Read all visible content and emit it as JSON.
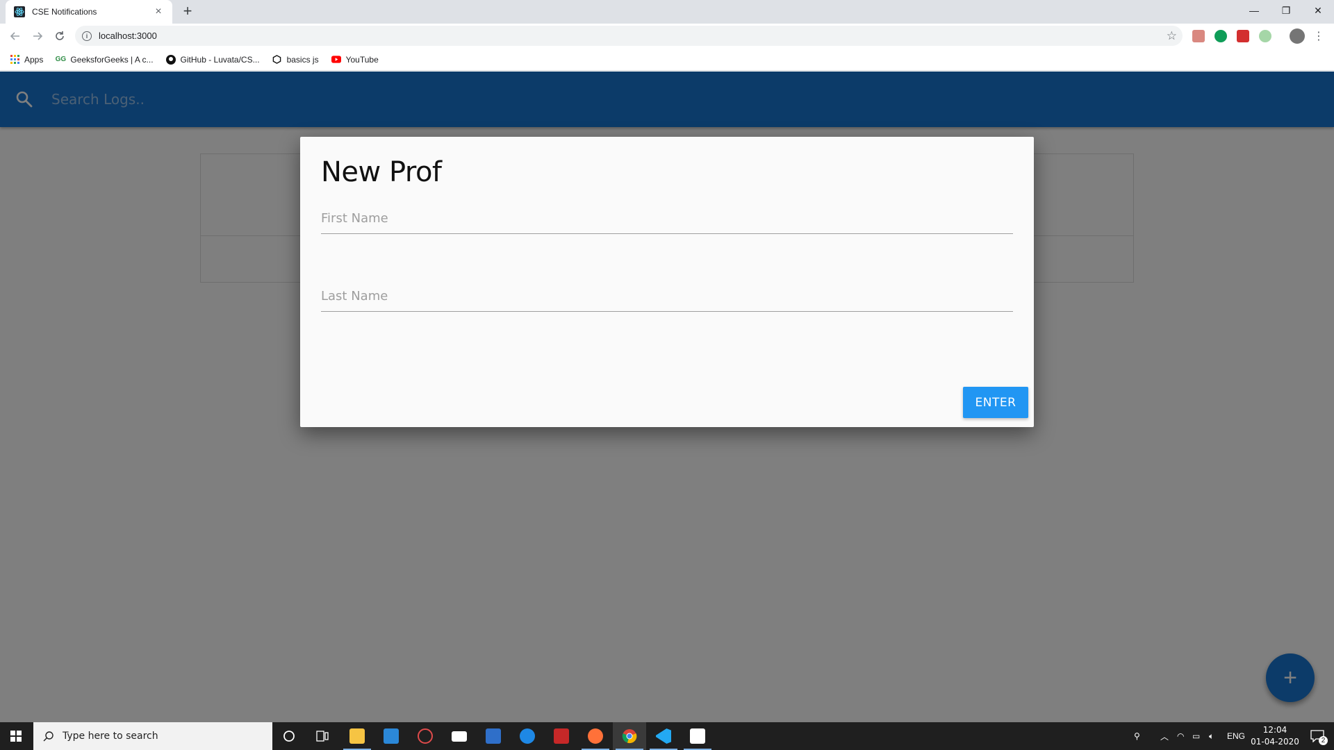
{
  "browser": {
    "tab_title": "CSE Notifications",
    "tab_close": "×",
    "new_tab": "+",
    "url": "localhost:3000",
    "window_controls": [
      "—",
      "❐",
      "✕"
    ],
    "bookmarks": [
      {
        "label": "Apps",
        "icon": "apps-grid-icon"
      },
      {
        "label": "GeeksforGeeks | A c...",
        "icon": "geeksforgeeks-icon"
      },
      {
        "label": "GitHub - Luvata/CS...",
        "icon": "github-icon"
      },
      {
        "label": "basics js",
        "icon": "codesandbox-icon"
      },
      {
        "label": "YouTube",
        "icon": "youtube-icon"
      }
    ]
  },
  "app": {
    "search_placeholder": "Search Logs..",
    "fab_label": "+"
  },
  "modal": {
    "title": "New Prof",
    "first_name_placeholder": "First Name",
    "last_name_placeholder": "Last Name",
    "enter_label": "ENTER"
  },
  "taskbar": {
    "search_placeholder": "Type here to search",
    "language": "ENG",
    "time": "12:04",
    "date": "01-04-2020",
    "notification_count": "2"
  },
  "colors": {
    "appbar": "#1976d2",
    "button": "#2196f3",
    "taskbar": "#1f1f1f"
  }
}
